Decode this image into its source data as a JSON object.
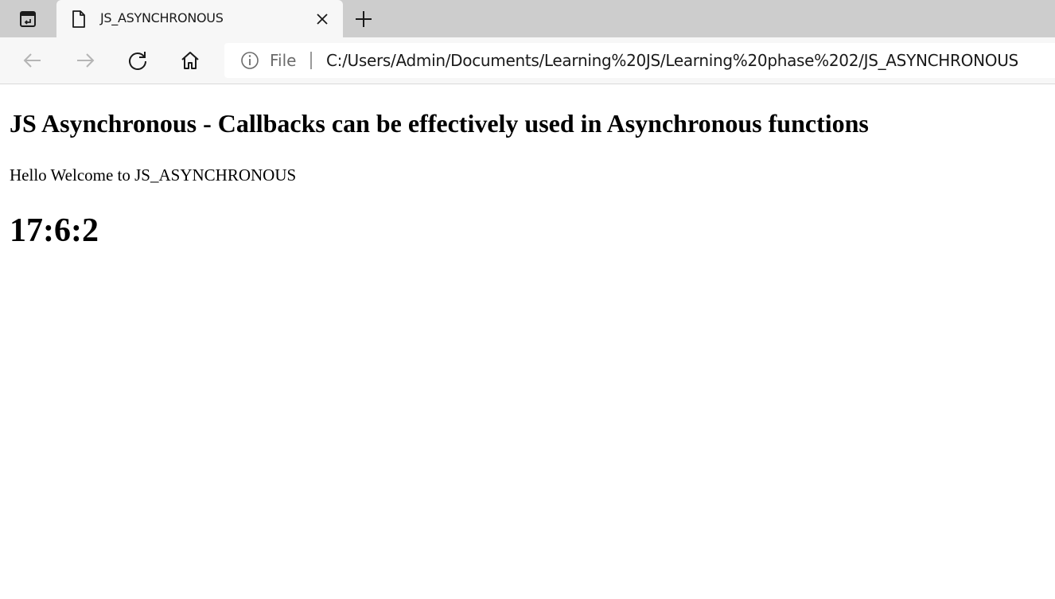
{
  "browser": {
    "tab": {
      "title": "JS_ASYNCHRONOUS",
      "favicon_icon": "page-icon",
      "close_icon": "close-icon"
    },
    "tab_actions_icon": "tab-actions-icon",
    "new_tab_icon": "plus-icon",
    "toolbar": {
      "back_icon": "arrow-left-icon",
      "forward_icon": "arrow-right-icon",
      "refresh_icon": "refresh-icon",
      "home_icon": "home-icon"
    },
    "address_bar": {
      "info_icon": "info-icon",
      "scheme_label": "File",
      "url": "C:/Users/Admin/Documents/Learning%20JS/Learning%20phase%202/JS_ASYNCHRONOUS"
    }
  },
  "page": {
    "heading": "JS Asynchronous - Callbacks can be effectively used in Asynchronous functions",
    "welcome": "Hello Welcome to JS_ASYNCHRONOUS",
    "clock": "17:6:2"
  },
  "colors": {
    "tabstrip_bg": "#cdcdcd",
    "toolbar_bg": "#f7f7f7",
    "page_bg": "#ffffff",
    "text": "#000000"
  }
}
